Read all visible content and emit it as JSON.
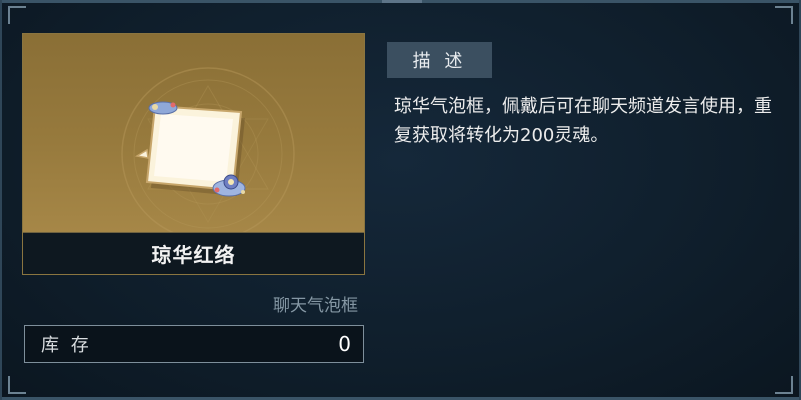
{
  "item": {
    "name": "琼华红络",
    "category": "聊天气泡框",
    "stock_label": "库 存",
    "stock_value": "0"
  },
  "description": {
    "tab_label": "描 述",
    "text": "琼华气泡框，佩戴后可在聊天频道发言使用，重复获取将转化为200灵魂。"
  },
  "icons": {
    "item_art": "chat-bubble-frame-icon",
    "emblem": "magic-circle-emblem"
  },
  "colors": {
    "card_gold": "#977a3d",
    "panel_bg": "#0f1e2b",
    "tab_bg": "#3b4f60"
  }
}
